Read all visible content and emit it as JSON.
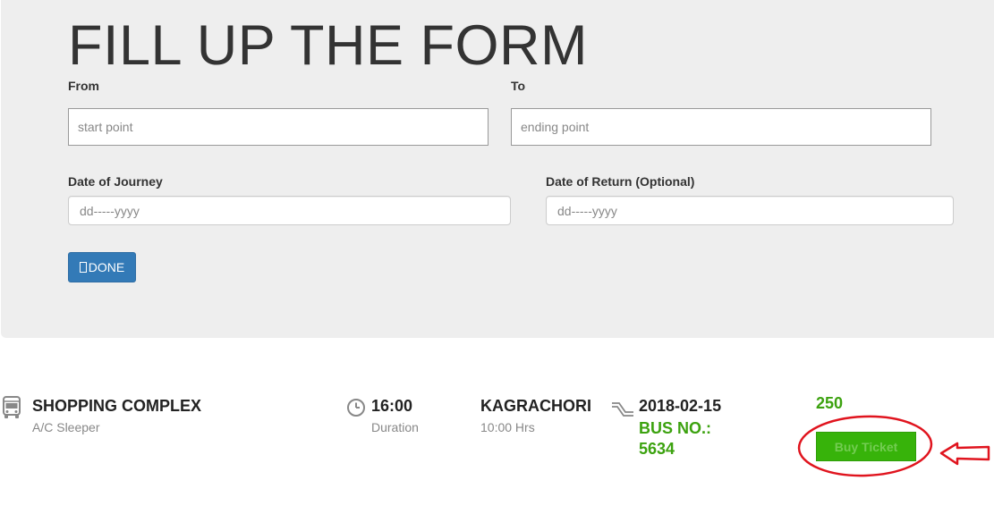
{
  "form": {
    "title": "FILL UP THE FORM",
    "from_label": "From",
    "from_placeholder": "start point",
    "to_label": "To",
    "to_placeholder": "ending point",
    "journey_date_label": "Date of Journey",
    "journey_date_placeholder": "dd-----yyyy",
    "return_date_label": "Date of Return (Optional)",
    "return_date_placeholder": "dd-----yyyy",
    "done_label": "DONE",
    "done_icon": "unsupported-glyph-icon"
  },
  "result": {
    "bus_icon": "bus-icon",
    "origin": "SHOPPING COMPLEX",
    "bus_type": "A/C Sleeper",
    "clock_icon": "clock-icon",
    "departure_time": "16:00",
    "duration_label": "Duration",
    "destination": "KAGRACHORI",
    "duration_value": "10:00 Hrs",
    "route_icon": "route-icon",
    "date": "2018-02-15",
    "bus_no": "BUS NO.: 5634",
    "price": "250",
    "buy_label": "Buy Ticket"
  },
  "annotation": {
    "shape": "red-ellipse-and-arrow",
    "color": "#e0141e"
  },
  "colors": {
    "panel_bg": "#eeeeee",
    "primary_button": "#337ab7",
    "success_green": "#3ca20f",
    "buy_button": "#37b30a"
  }
}
